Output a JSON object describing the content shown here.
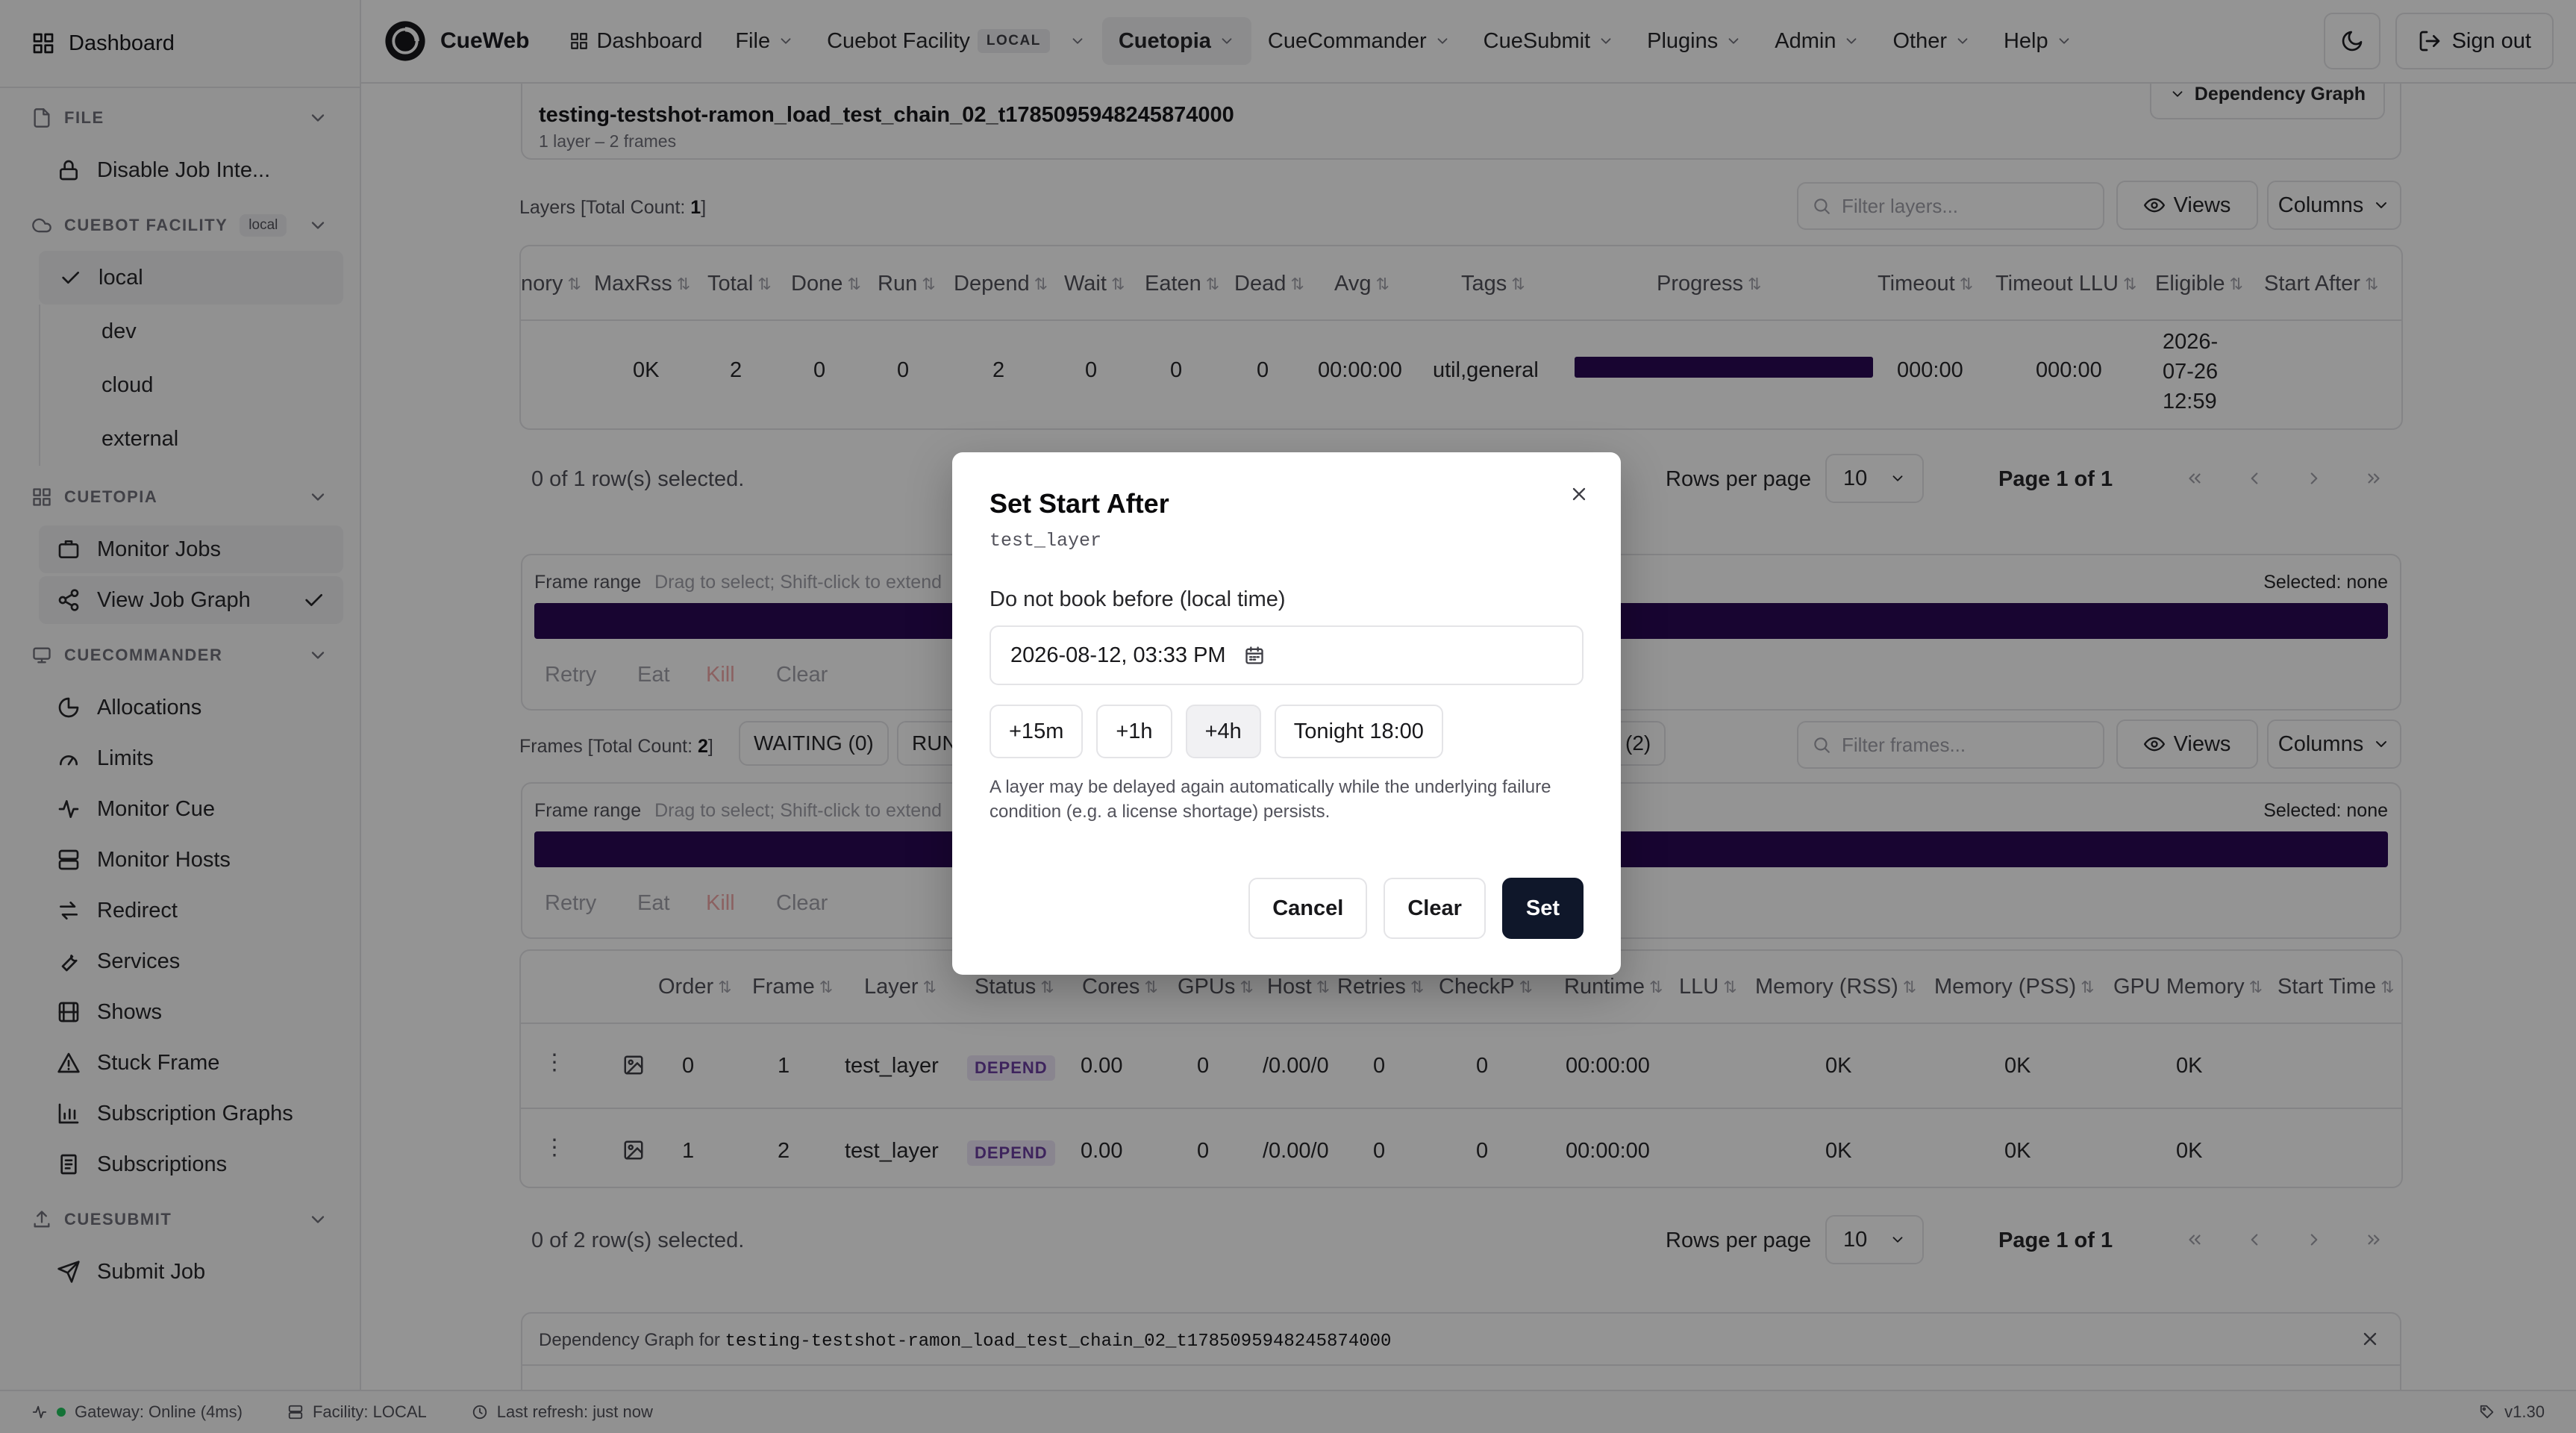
{
  "sidebar": {
    "dashboard": "Dashboard",
    "sections": {
      "file": "FILE",
      "cuebot": "CUEBOT FACILITY",
      "cuebot_badge": "local",
      "cuetopia": "CUETOPIA",
      "cuecommander": "CUECOMMANDER",
      "cuesubmit": "CUESUBMIT"
    },
    "file_items": [
      "Disable Job Inte..."
    ],
    "facilities": [
      "local",
      "dev",
      "cloud",
      "external"
    ],
    "cuetopia_items": [
      "Monitor Jobs",
      "View Job Graph"
    ],
    "cuecommander_items": [
      "Allocations",
      "Limits",
      "Monitor Cue",
      "Monitor Hosts",
      "Redirect",
      "Services",
      "Shows",
      "Stuck Frame",
      "Subscription Graphs",
      "Subscriptions"
    ],
    "cuesubmit_items": [
      "Submit Job"
    ]
  },
  "header": {
    "brand": "CueWeb",
    "nav": [
      "Dashboard",
      "File",
      "Cuebot Facility",
      "Cuetopia",
      "CueCommander",
      "CueSubmit",
      "Plugins",
      "Admin",
      "Other",
      "Help"
    ],
    "facility_badge": "LOCAL",
    "sign_out": "Sign out"
  },
  "job": {
    "name": "testing-testshot-ramon_load_test_chain_02_t1785095948245874000",
    "meta": "1 layer – 2 frames",
    "dependency_graph_button": "Dependency Graph"
  },
  "layers": {
    "title_prefix": "Layers [Total Count: ",
    "count": "1",
    "title_suffix": "]",
    "filter_placeholder": "Filter layers...",
    "views": "Views",
    "columns_btn": "Columns",
    "columns": [
      "nory",
      "MaxRss",
      "Total",
      "Done",
      "Run",
      "Depend",
      "Wait",
      "Eaten",
      "Dead",
      "Avg",
      "Tags",
      "Progress",
      "Timeout",
      "Timeout LLU",
      "Eligible",
      "Start After"
    ],
    "row": {
      "maxrss": "0K",
      "total": "2",
      "done": "0",
      "run": "0",
      "depend": "2",
      "wait": "0",
      "eaten": "0",
      "dead": "0",
      "avg": "00:00:00",
      "tags": "util,general",
      "progress": 1.0,
      "timeout": "000:00",
      "timeout_llu": "000:00",
      "eligible_1": "2026-",
      "eligible_2": "07-26",
      "eligible_3": "12:59"
    },
    "selected": "0 of 1 row(s) selected.",
    "rows_per_page": "Rows per page",
    "rpp_value": "10",
    "page": "Page 1 of 1"
  },
  "frame_range": {
    "label": "Frame range",
    "hint": "Drag to select; Shift-click to extend",
    "selected": "Selected: none",
    "actions": [
      "Retry",
      "Eat",
      "Kill",
      "Clear"
    ]
  },
  "frames": {
    "title_prefix": "Frames [Total Count: ",
    "count": "2",
    "title_suffix": "]",
    "status_tabs": [
      "WAITING (0)",
      "RUN"
    ],
    "tab_right": "D (2)",
    "filter_placeholder": "Filter frames...",
    "views": "Views",
    "columns_btn": "Columns",
    "columns": [
      "Order",
      "Frame",
      "Layer",
      "Status",
      "Cores",
      "GPUs",
      "Host",
      "Retries",
      "CheckP",
      "Runtime",
      "LLU",
      "Memory (RSS)",
      "Memory (PSS)",
      "GPU Memory",
      "Start Time"
    ],
    "rows": [
      {
        "order": "0",
        "frame": "1",
        "layer": "test_layer",
        "status": "DEPEND",
        "cores": "0.00",
        "gpus": "0",
        "host": "/0.00/0",
        "retries": "0",
        "checkp": "0",
        "runtime": "00:00:00",
        "rss": "0K",
        "pss": "0K",
        "gpumem": "0K"
      },
      {
        "order": "1",
        "frame": "2",
        "layer": "test_layer",
        "status": "DEPEND",
        "cores": "0.00",
        "gpus": "0",
        "host": "/0.00/0",
        "retries": "0",
        "checkp": "0",
        "runtime": "00:00:00",
        "rss": "0K",
        "pss": "0K",
        "gpumem": "0K"
      }
    ],
    "selected": "0 of 2 row(s) selected.",
    "rows_per_page": "Rows per page",
    "rpp_value": "10",
    "page": "Page 1 of 1"
  },
  "depgraph": {
    "prefix": "Dependency Graph for",
    "job": "testing-testshot-ramon_load_test_chain_02_t1785095948245874000"
  },
  "statusbar": {
    "gateway": "Gateway: Online (4ms)",
    "facility": "Facility: LOCAL",
    "refresh": "Last refresh: just now",
    "version": "v1.30"
  },
  "dialog": {
    "title": "Set Start After",
    "subtitle": "test_layer",
    "label": "Do not book before (local time)",
    "value": "2026-08-12, 03:33 PM",
    "quick": [
      "+15m",
      "+1h",
      "+4h",
      "Tonight 18:00"
    ],
    "help": "A layer may be delayed again automatically while the underlying failure condition (e.g. a license shortage) persists.",
    "cancel": "Cancel",
    "clear": "Clear",
    "set": "Set"
  }
}
